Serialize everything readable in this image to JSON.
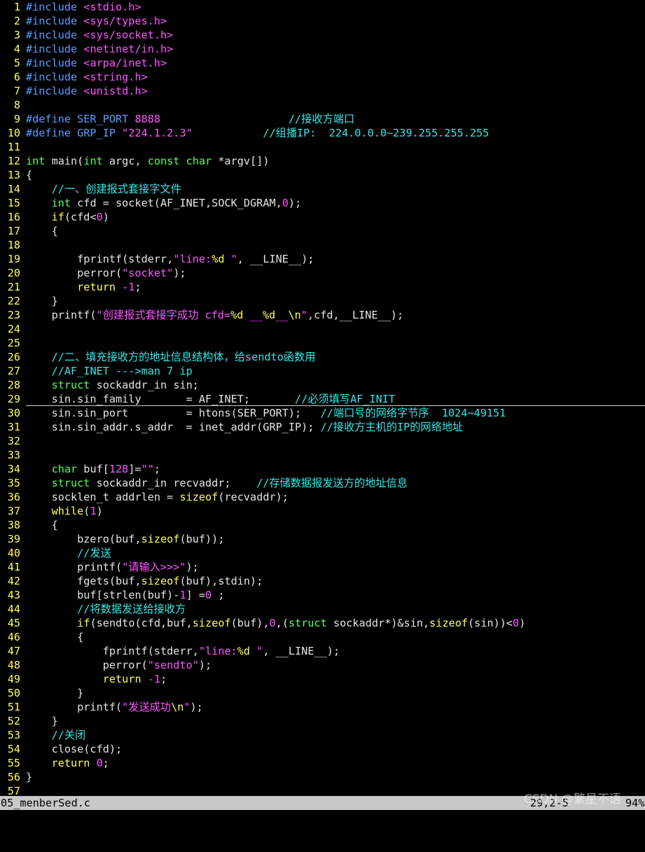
{
  "editor": {
    "colors": {
      "background": "#000000",
      "line_number": "#ffff55",
      "preprocessor": "#5c9cff",
      "include_path": "#ff55ff",
      "string_number": "#ff55ff",
      "comment": "#33e6e6",
      "keyword": "#ffff55",
      "type": "#5aff5a",
      "text": "#e5e5e5",
      "statusbar": "#c8c8c8"
    },
    "cursor_line": 29,
    "lines": [
      [
        [
          "pp",
          "#include "
        ],
        [
          "inc",
          "<stdio.h>"
        ]
      ],
      [
        [
          "pp",
          "#include "
        ],
        [
          "inc",
          "<sys/types.h>"
        ]
      ],
      [
        [
          "pp",
          "#include "
        ],
        [
          "inc",
          "<sys/socket.h>"
        ]
      ],
      [
        [
          "pp",
          "#include "
        ],
        [
          "inc",
          "<netinet/in.h>"
        ]
      ],
      [
        [
          "pp",
          "#include "
        ],
        [
          "inc",
          "<arpa/inet.h>"
        ]
      ],
      [
        [
          "pp",
          "#include "
        ],
        [
          "inc",
          "<string.h>"
        ]
      ],
      [
        [
          "pp",
          "#include "
        ],
        [
          "inc",
          "<unistd.h>"
        ]
      ],
      [],
      [
        [
          "pp",
          "#define SER_PORT "
        ],
        [
          "num",
          "8888"
        ],
        [
          "tx",
          "                    "
        ],
        [
          "cmt",
          "//接收方端口"
        ]
      ],
      [
        [
          "pp",
          "#define GRP_IP "
        ],
        [
          "str",
          "\"224.1.2.3\""
        ],
        [
          "tx",
          "           "
        ],
        [
          "cmt",
          "//组播IP:  224.0.0.0~239.255.255.255"
        ]
      ],
      [],
      [
        [
          "ty",
          "int"
        ],
        [
          "tx",
          " main("
        ],
        [
          "ty",
          "int"
        ],
        [
          "tx",
          " argc, "
        ],
        [
          "ty",
          "const"
        ],
        [
          "tx",
          " "
        ],
        [
          "ty",
          "char"
        ],
        [
          "tx",
          " *argv[])"
        ]
      ],
      [
        [
          "tx",
          "{"
        ]
      ],
      [
        [
          "tx",
          "    "
        ],
        [
          "cmt",
          "//一、创建报式套接字文件"
        ]
      ],
      [
        [
          "tx",
          "    "
        ],
        [
          "ty",
          "int"
        ],
        [
          "tx",
          " cfd = socket(AF_INET,SOCK_DGRAM,"
        ],
        [
          "num",
          "0"
        ],
        [
          "tx",
          ");"
        ]
      ],
      [
        [
          "tx",
          "    "
        ],
        [
          "kw",
          "if"
        ],
        [
          "tx",
          "(cfd<"
        ],
        [
          "num",
          "0"
        ],
        [
          "tx",
          ")"
        ]
      ],
      [
        [
          "tx",
          "    {"
        ]
      ],
      [],
      [
        [
          "tx",
          "        fprintf(stderr,"
        ],
        [
          "str",
          "\"line:"
        ],
        [
          "kw",
          "%d"
        ],
        [
          "str",
          " \""
        ],
        [
          "tx",
          ", __LINE__);"
        ]
      ],
      [
        [
          "tx",
          "        perror("
        ],
        [
          "str",
          "\"socket\""
        ],
        [
          "tx",
          ");"
        ]
      ],
      [
        [
          "tx",
          "        "
        ],
        [
          "kw",
          "return"
        ],
        [
          "tx",
          " "
        ],
        [
          "num",
          "-1"
        ],
        [
          "tx",
          ";"
        ]
      ],
      [
        [
          "tx",
          "    }"
        ]
      ],
      [
        [
          "tx",
          "    printf("
        ],
        [
          "str",
          "\"创建报式套接字成功 cfd="
        ],
        [
          "kw",
          "%d"
        ],
        [
          "str",
          " __"
        ],
        [
          "kw",
          "%d"
        ],
        [
          "str",
          "__"
        ],
        [
          "kw",
          "\\n"
        ],
        [
          "str",
          "\""
        ],
        [
          "tx",
          ",cfd,__LINE__);"
        ]
      ],
      [],
      [],
      [
        [
          "tx",
          "    "
        ],
        [
          "cmt",
          "//二、填充接收方的地址信息结构体，给sendto函数用"
        ]
      ],
      [
        [
          "tx",
          "    "
        ],
        [
          "cmt",
          "//AF_INET --->man 7 ip"
        ]
      ],
      [
        [
          "tx",
          "    "
        ],
        [
          "ty",
          "struct"
        ],
        [
          "tx",
          " sockaddr_in sin;"
        ]
      ],
      [
        [
          "tx",
          "    sin.sin_family       = AF_INET;       "
        ],
        [
          "cmt",
          "//必须填写AF_INIT"
        ]
      ],
      [
        [
          "tx",
          "    sin.sin_port         = htons(SER_PORT);   "
        ],
        [
          "cmt",
          "//端口号的网络字节序  1024~49151"
        ]
      ],
      [
        [
          "tx",
          "    sin.sin_addr.s_addr  = inet_addr(GRP_IP); "
        ],
        [
          "cmt",
          "//接收方主机的IP的网络地址"
        ]
      ],
      [],
      [],
      [
        [
          "tx",
          "    "
        ],
        [
          "ty",
          "char"
        ],
        [
          "tx",
          " buf["
        ],
        [
          "num",
          "128"
        ],
        [
          "tx",
          "]="
        ],
        [
          "str",
          "\"\""
        ],
        [
          "tx",
          ";"
        ]
      ],
      [
        [
          "tx",
          "    "
        ],
        [
          "ty",
          "struct"
        ],
        [
          "tx",
          " sockaddr_in recvaddr;    "
        ],
        [
          "cmt",
          "//存储数据报发送方的地址信息"
        ]
      ],
      [
        [
          "tx",
          "    socklen_t addrlen = "
        ],
        [
          "kw",
          "sizeof"
        ],
        [
          "tx",
          "(recvaddr);"
        ]
      ],
      [
        [
          "tx",
          "    "
        ],
        [
          "kw",
          "while"
        ],
        [
          "tx",
          "("
        ],
        [
          "num",
          "1"
        ],
        [
          "tx",
          ")"
        ]
      ],
      [
        [
          "tx",
          "    {"
        ]
      ],
      [
        [
          "tx",
          "        bzero(buf,"
        ],
        [
          "kw",
          "sizeof"
        ],
        [
          "tx",
          "(buf));"
        ]
      ],
      [
        [
          "tx",
          "        "
        ],
        [
          "cmt",
          "//发送"
        ]
      ],
      [
        [
          "tx",
          "        printf("
        ],
        [
          "str",
          "\"请输入>>>\""
        ],
        [
          "tx",
          ");"
        ]
      ],
      [
        [
          "tx",
          "        fgets(buf,"
        ],
        [
          "kw",
          "sizeof"
        ],
        [
          "tx",
          "(buf),stdin);"
        ]
      ],
      [
        [
          "tx",
          "        buf[strlen(buf)-"
        ],
        [
          "num",
          "1"
        ],
        [
          "tx",
          "] ="
        ],
        [
          "num",
          "0"
        ],
        [
          "tx",
          " ;"
        ]
      ],
      [
        [
          "tx",
          "        "
        ],
        [
          "cmt",
          "//将数据发送给接收方"
        ]
      ],
      [
        [
          "tx",
          "        "
        ],
        [
          "kw",
          "if"
        ],
        [
          "tx",
          "(sendto(cfd,buf,"
        ],
        [
          "kw",
          "sizeof"
        ],
        [
          "tx",
          "(buf),"
        ],
        [
          "num",
          "0"
        ],
        [
          "tx",
          ",("
        ],
        [
          "ty",
          "struct"
        ],
        [
          "tx",
          " sockaddr*)&sin,"
        ],
        [
          "kw",
          "sizeof"
        ],
        [
          "tx",
          "(sin))<"
        ],
        [
          "num",
          "0"
        ],
        [
          "tx",
          ")"
        ]
      ],
      [
        [
          "tx",
          "        {"
        ]
      ],
      [
        [
          "tx",
          "            fprintf(stderr,"
        ],
        [
          "str",
          "\"line:"
        ],
        [
          "kw",
          "%d"
        ],
        [
          "str",
          " \""
        ],
        [
          "tx",
          ", __LINE__);"
        ]
      ],
      [
        [
          "tx",
          "            perror("
        ],
        [
          "str",
          "\"sendto\""
        ],
        [
          "tx",
          ");"
        ]
      ],
      [
        [
          "tx",
          "            "
        ],
        [
          "kw",
          "return"
        ],
        [
          "tx",
          " "
        ],
        [
          "num",
          "-1"
        ],
        [
          "tx",
          ";"
        ]
      ],
      [
        [
          "tx",
          "        }"
        ]
      ],
      [
        [
          "tx",
          "        printf("
        ],
        [
          "str",
          "\"发送成功"
        ],
        [
          "kw",
          "\\n"
        ],
        [
          "str",
          "\""
        ],
        [
          "tx",
          ");"
        ]
      ],
      [
        [
          "tx",
          "    }"
        ]
      ],
      [
        [
          "tx",
          "    "
        ],
        [
          "cmt",
          "//关闭"
        ]
      ],
      [
        [
          "tx",
          "    close(cfd);"
        ]
      ],
      [
        [
          "tx",
          "    "
        ],
        [
          "kw",
          "return"
        ],
        [
          "tx",
          " "
        ],
        [
          "num",
          "0"
        ],
        [
          "tx",
          ";"
        ]
      ],
      [
        [
          "tx",
          "}"
        ]
      ],
      []
    ]
  },
  "statusbar": {
    "filename": "05_menberSed.c",
    "position": "29,2-5",
    "percent": "94%"
  },
  "watermark": "CSDN @繁星不语"
}
